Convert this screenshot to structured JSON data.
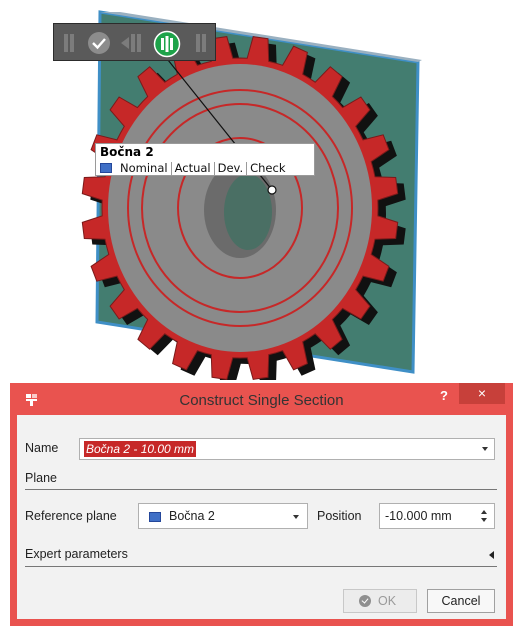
{
  "viewport": {
    "element_label": {
      "title": "Bočna 2",
      "columns": [
        "Nominal",
        "Actual",
        "Dev.",
        "Check"
      ]
    },
    "toolbar": {
      "icons": [
        "previous-step-icon",
        "confirm-icon",
        "next-step-icon",
        "section-tool-icon",
        "last-step-icon"
      ]
    },
    "colors": {
      "gear": "#8a8a8a",
      "teeth_highlight": "#c62828",
      "plane": "#2f6f60",
      "plane_edge": "#3f8fc6",
      "toolbar_active": "#1ea34a"
    }
  },
  "dialog": {
    "title": "Construct Single Section",
    "help": "?",
    "close": "×",
    "name_label": "Name",
    "name_value": "Bočna 2 - 10.00 mm",
    "plane_section": "Plane",
    "reference_plane_label": "Reference plane",
    "reference_plane_value": "Bočna 2",
    "position_label": "Position",
    "position_value": "-10.000 mm",
    "expert_parameters": "Expert parameters",
    "ok_label": "OK",
    "cancel_label": "Cancel",
    "colors": {
      "frame": "#e9534f",
      "close_button": "#c7403a",
      "name_highlight": "#c62828"
    }
  }
}
